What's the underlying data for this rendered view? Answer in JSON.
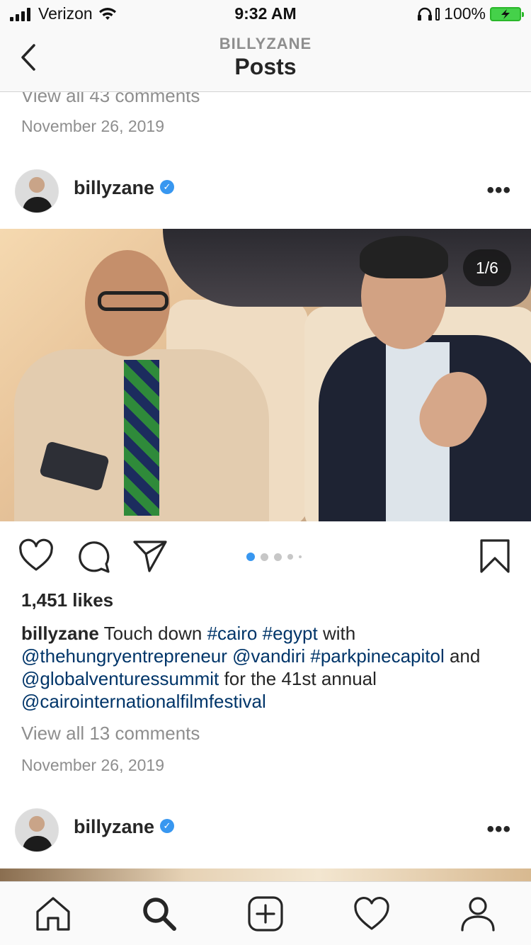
{
  "status_bar": {
    "carrier": "Verizon",
    "time": "9:32 AM",
    "battery": "100%"
  },
  "header": {
    "account": "BILLYZANE",
    "title": "Posts"
  },
  "previous_post": {
    "view_comments": "View all 43 comments",
    "date": "November 26, 2019"
  },
  "post": {
    "username": "billyzane",
    "verified": true,
    "more_label": "•••",
    "image_counter": "1/6",
    "carousel": {
      "current": 1,
      "total": 6
    },
    "likes": "1,451 likes",
    "caption": {
      "author": "billyzane",
      "segments": [
        {
          "text": " Touch down ",
          "type": "text"
        },
        {
          "text": "#cairo",
          "type": "tag"
        },
        {
          "text": " ",
          "type": "text"
        },
        {
          "text": "#egypt",
          "type": "tag"
        },
        {
          "text": " with ",
          "type": "text"
        },
        {
          "text": "@thehungryentrepreneur",
          "type": "tag"
        },
        {
          "text": " ",
          "type": "text"
        },
        {
          "text": "@vandiri",
          "type": "tag"
        },
        {
          "text": " ",
          "type": "text"
        },
        {
          "text": "#parkpinecapitol",
          "type": "tag"
        },
        {
          "text": " and ",
          "type": "text"
        },
        {
          "text": "@globalventuressummit",
          "type": "tag"
        },
        {
          "text": " for the 41st annual ",
          "type": "text"
        },
        {
          "text": "@cairointernationalfilmfestival",
          "type": "tag"
        }
      ]
    },
    "view_comments": "View all 13 comments",
    "date": "November 26, 2019"
  },
  "next_post": {
    "username": "billyzane",
    "verified": true,
    "more_label": "•••"
  },
  "icons": {
    "back": "chevron-left-icon",
    "like": "heart-icon",
    "comment": "comment-icon",
    "share": "paper-plane-icon",
    "save": "bookmark-icon",
    "verified": "verified-badge-icon"
  },
  "tab_bar": [
    "home-icon",
    "search-icon",
    "add-post-icon",
    "activity-heart-icon",
    "profile-icon"
  ],
  "colors": {
    "link": "#003569",
    "verified": "#3897f0",
    "carousel_active": "#3897f0",
    "muted": "#8e8e8e",
    "battery": "#45d14a"
  }
}
